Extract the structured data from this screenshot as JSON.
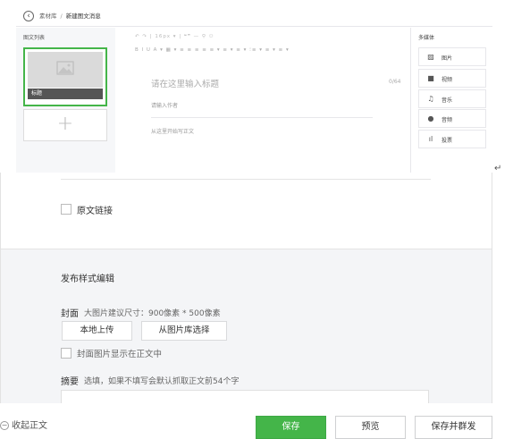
{
  "breadcrumb": {
    "back_icon": "chevron-left-icon",
    "parent": "素材库",
    "separator": "/",
    "current": "新建图文消息"
  },
  "left_panel": {
    "title": "图文列表",
    "cards": [
      {
        "label": "标题",
        "thumbnail_icon": "image-placeholder-icon"
      }
    ],
    "add_glyph": "+"
  },
  "editor": {
    "toolbar_row1": "↶  ↷  |  16px ▾  |  ❝❞   —   ⚲   ⚇",
    "toolbar_row2": "B  I  U  A ▾  ▦ ▾  ≡  ≡  ≡  ≡  ≡  ▾  ≡ ▾  ≡ ▾  ⁝≡ ▾  ≡ ▾  ≡ ▾",
    "title_placeholder": "请在这里输入标题",
    "title_count": "0/64",
    "author_placeholder": "请输入作者",
    "body_placeholder": "从这里开始写正文"
  },
  "media_panel": {
    "title": "多媒体",
    "items": [
      {
        "label": "图片",
        "icon": "image-icon",
        "glyph": "▨"
      },
      {
        "label": "视频",
        "icon": "video-icon",
        "glyph": "■"
      },
      {
        "label": "音乐",
        "icon": "music-icon",
        "glyph": "♫"
      },
      {
        "label": "音频",
        "icon": "microphone-icon",
        "glyph": "●"
      },
      {
        "label": "投票",
        "icon": "vote-icon",
        "glyph": "ıl"
      }
    ]
  },
  "return_glyph": "↵",
  "original_link": {
    "label": "原文链接",
    "checked": false
  },
  "publish": {
    "section_title": "发布样式编辑",
    "cover_label": "封面",
    "cover_hint": "大图片建议尺寸：900像素 * 500像素",
    "upload_local": "本地上传",
    "choose_library": "从图片库选择",
    "show_cover_label": "封面图片显示在正文中",
    "show_cover_checked": false,
    "summary_label": "摘要",
    "summary_hint": "选填，如果不填写会默认抓取正文前54个字"
  },
  "footer": {
    "collapse_label": "收起正文",
    "collapse_icon": "minus-circle-icon",
    "save": "保存",
    "preview": "预览",
    "save_and_send": "保存并群发"
  },
  "colors": {
    "accent": "#44b549",
    "panel_grey": "#f4f5f7"
  }
}
